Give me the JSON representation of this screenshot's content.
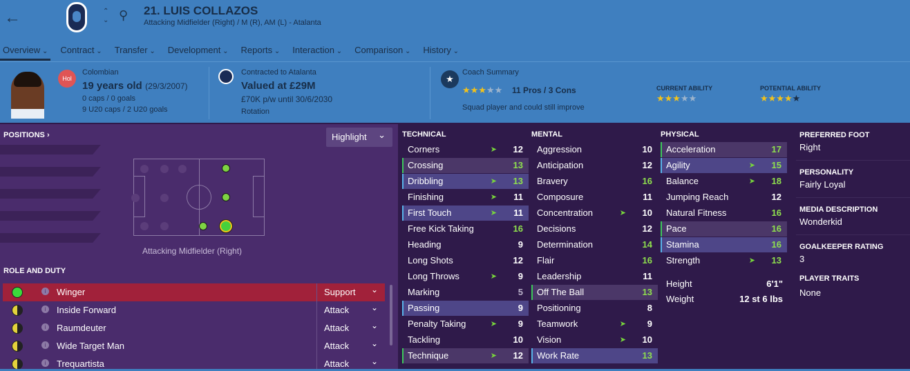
{
  "header": {
    "name": "21. LUIS COLLAZOS",
    "subtitle": "Attacking Midfielder (Right) / M (R), AM (L) - Atalanta"
  },
  "tabs": [
    "Overview",
    "Contract",
    "Transfer",
    "Development",
    "Reports",
    "Interaction",
    "Comparison",
    "History"
  ],
  "bio": {
    "nationality": "Colombian",
    "nat_badge": "Hol",
    "age": "19 years old",
    "dob": "(29/3/2007)",
    "caps": "0 caps / 0 goals",
    "u20": "9 U20 caps / 2 U20 goals"
  },
  "contract": {
    "club": "Contracted to Atalanta",
    "value": "Valued at £29M",
    "wage": "£70K p/w until 30/6/2030",
    "status": "Rotation"
  },
  "coach": {
    "label": "Coach Summary",
    "stars": 3.5,
    "proscons": "11 Pros / 3 Cons",
    "summary": "Squad player and could still improve"
  },
  "ability": {
    "current_label": "CURRENT ABILITY",
    "current_stars": 3,
    "potential_label": "POTENTIAL ABILITY",
    "potential_stars": 4.5
  },
  "positions": {
    "header": "POSITIONS ›",
    "highlight": "Highlight",
    "caption": "Attacking Midfielder (Right)"
  },
  "role_duty": {
    "header": "ROLE AND DUTY",
    "roles": [
      {
        "name": "Winger",
        "duty": "Support",
        "rating": "full"
      },
      {
        "name": "Inside Forward",
        "duty": "Attack",
        "rating": "half"
      },
      {
        "name": "Raumdeuter",
        "duty": "Attack",
        "rating": "half"
      },
      {
        "name": "Wide Target Man",
        "duty": "Attack",
        "rating": "half"
      },
      {
        "name": "Trequartista",
        "duty": "Attack",
        "rating": "half"
      }
    ]
  },
  "technical": {
    "header": "TECHNICAL",
    "items": [
      {
        "label": "Corners",
        "value": "12",
        "arrow": true
      },
      {
        "label": "Crossing",
        "value": "13",
        "arrow": false
      },
      {
        "label": "Dribbling",
        "value": "13",
        "arrow": true
      },
      {
        "label": "Finishing",
        "value": "11",
        "arrow": true
      },
      {
        "label": "First Touch",
        "value": "11",
        "arrow": true
      },
      {
        "label": "Free Kick Taking",
        "value": "16",
        "arrow": false
      },
      {
        "label": "Heading",
        "value": "9",
        "arrow": false
      },
      {
        "label": "Long Shots",
        "value": "12",
        "arrow": false
      },
      {
        "label": "Long Throws",
        "value": "9",
        "arrow": true
      },
      {
        "label": "Marking",
        "value": "5",
        "arrow": false
      },
      {
        "label": "Passing",
        "value": "9",
        "arrow": false
      },
      {
        "label": "Penalty Taking",
        "value": "9",
        "arrow": true
      },
      {
        "label": "Tackling",
        "value": "10",
        "arrow": false
      },
      {
        "label": "Technique",
        "value": "12",
        "arrow": true
      }
    ]
  },
  "mental": {
    "header": "MENTAL",
    "items": [
      {
        "label": "Aggression",
        "value": "10",
        "arrow": false
      },
      {
        "label": "Anticipation",
        "value": "12",
        "arrow": false
      },
      {
        "label": "Bravery",
        "value": "16",
        "arrow": false
      },
      {
        "label": "Composure",
        "value": "11",
        "arrow": false
      },
      {
        "label": "Concentration",
        "value": "10",
        "arrow": true
      },
      {
        "label": "Decisions",
        "value": "12",
        "arrow": false
      },
      {
        "label": "Determination",
        "value": "14",
        "arrow": false
      },
      {
        "label": "Flair",
        "value": "16",
        "arrow": false
      },
      {
        "label": "Leadership",
        "value": "11",
        "arrow": false
      },
      {
        "label": "Off The Ball",
        "value": "13",
        "arrow": false
      },
      {
        "label": "Positioning",
        "value": "8",
        "arrow": false
      },
      {
        "label": "Teamwork",
        "value": "9",
        "arrow": true
      },
      {
        "label": "Vision",
        "value": "10",
        "arrow": true
      },
      {
        "label": "Work Rate",
        "value": "13",
        "arrow": false
      }
    ]
  },
  "physical": {
    "header": "PHYSICAL",
    "items": [
      {
        "label": "Acceleration",
        "value": "17",
        "arrow": false
      },
      {
        "label": "Agility",
        "value": "15",
        "arrow": true
      },
      {
        "label": "Balance",
        "value": "18",
        "arrow": true
      },
      {
        "label": "Jumping Reach",
        "value": "12",
        "arrow": false
      },
      {
        "label": "Natural Fitness",
        "value": "16",
        "arrow": false
      },
      {
        "label": "Pace",
        "value": "16",
        "arrow": false
      },
      {
        "label": "Stamina",
        "value": "16",
        "arrow": false
      },
      {
        "label": "Strength",
        "value": "13",
        "arrow": true
      }
    ],
    "height_label": "Height",
    "height": "6'1\"",
    "weight_label": "Weight",
    "weight": "12 st 6 lbs"
  },
  "info": [
    {
      "label": "PREFERRED FOOT",
      "value": "Right"
    },
    {
      "label": "PERSONALITY",
      "value": "Fairly Loyal"
    },
    {
      "label": "MEDIA DESCRIPTION",
      "value": "Wonderkid"
    },
    {
      "label": "GOALKEEPER RATING",
      "value": "3"
    },
    {
      "label": "PLAYER TRAITS",
      "value": "None"
    }
  ],
  "colors": {
    "header": "#3f7fbf",
    "panel": "#4a2c6c",
    "attr_bg": "#2f1a4a",
    "selected_role": "#a1213a",
    "high_value": "#8fe04e"
  }
}
